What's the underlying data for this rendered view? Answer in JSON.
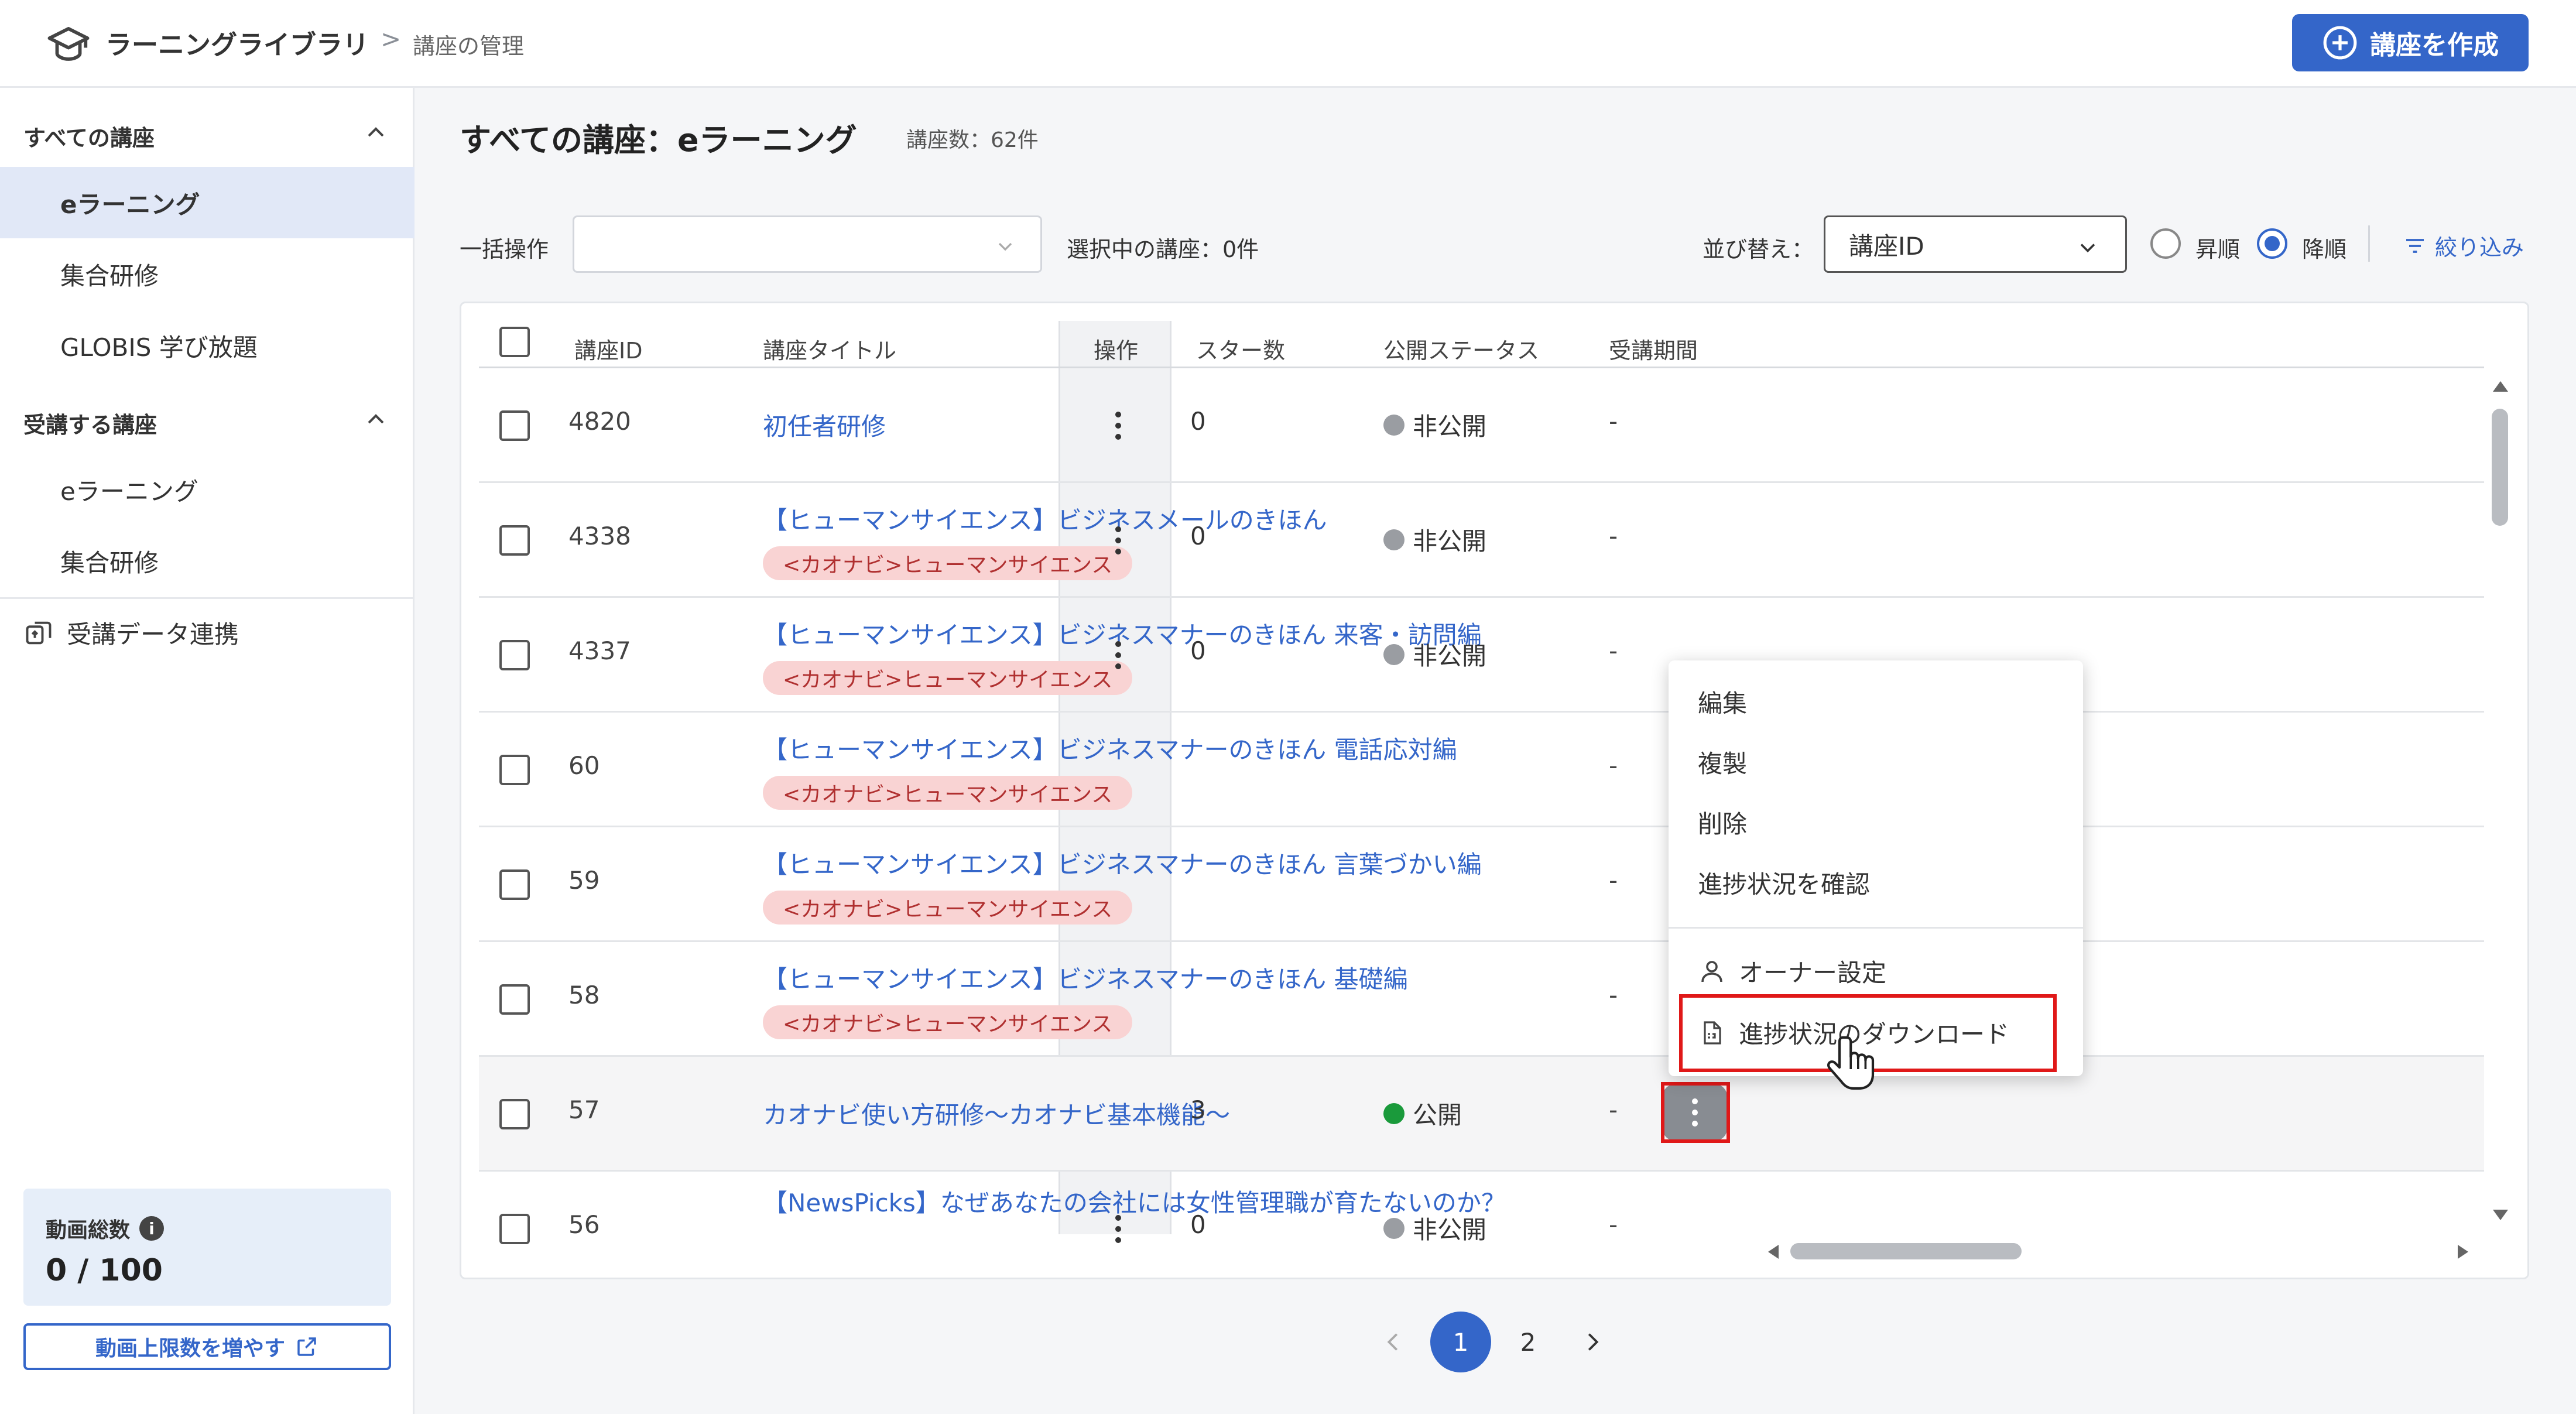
{
  "header": {
    "title": "ラーニングライブラリ",
    "breadcrumb_separator": ">",
    "breadcrumb_current": "講座の管理",
    "create_button": "講座を作成"
  },
  "sidebar": {
    "section_all": "すべての講座",
    "all_items": [
      "eラーニング",
      "集合研修",
      "GLOBIS 学び放題"
    ],
    "section_enrolled": "受講する講座",
    "enrolled_items": [
      "eラーニング",
      "集合研修"
    ],
    "data_sync": "受講データ連携",
    "video_total_label": "動画総数",
    "video_total_value": "0 / 100",
    "increase_button": "動画上限数を増やす"
  },
  "main": {
    "title": "すべての講座：eラーニング",
    "count": "講座数：62件"
  },
  "toolbar": {
    "bulk_label": "一括操作",
    "bulk_placeholder": "",
    "selected_label": "選択中の講座：0件",
    "sort_label": "並び替え：",
    "sort_value": "講座ID",
    "asc_label": "昇順",
    "desc_label": "降順",
    "filter_label": "絞り込み"
  },
  "table": {
    "headers": {
      "id": "講座ID",
      "title": "講座タイトル",
      "ops": "操作",
      "stars": "スター数",
      "status": "公開ステータス",
      "period": "受講期間"
    },
    "rows": [
      {
        "id": "4820",
        "title": "初任者研修",
        "tag": "",
        "stars": "0",
        "status": "非公開",
        "period": "-"
      },
      {
        "id": "4338",
        "title": "【ヒューマンサイエンス】ビジネスメールのきほん",
        "tag": "<カオナビ>ヒューマンサイエンス",
        "stars": "0",
        "status": "非公開",
        "period": "-"
      },
      {
        "id": "4337",
        "title": "【ヒューマンサイエンス】ビジネスマナーのきほん 来客・訪問編",
        "tag": "<カオナビ>ヒューマンサイエンス",
        "stars": "0",
        "status": "非公開",
        "period": "-"
      },
      {
        "id": "60",
        "title": "【ヒューマンサイエンス】ビジネスマナーのきほん 電話応対編",
        "tag": "<カオナビ>ヒューマンサイエンス",
        "stars": "",
        "status": "",
        "period": "-"
      },
      {
        "id": "59",
        "title": "【ヒューマンサイエンス】ビジネスマナーのきほん 言葉づかい編",
        "tag": "<カオナビ>ヒューマンサイエンス",
        "stars": "",
        "status": "",
        "period": "-"
      },
      {
        "id": "58",
        "title": "【ヒューマンサイエンス】ビジネスマナーのきほん 基礎編",
        "tag": "<カオナビ>ヒューマンサイエンス",
        "stars": "",
        "status": "",
        "period": "-"
      },
      {
        "id": "57",
        "title": "カオナビ使い方研修〜カオナビ基本機能〜",
        "tag": "",
        "stars": "3",
        "status": "公開",
        "period": "-"
      },
      {
        "id": "56",
        "title": "【NewsPicks】なぜあなたの会社には女性管理職が育たないのか？",
        "tag": "",
        "stars": "0",
        "status": "非公開",
        "period": "-"
      }
    ]
  },
  "menu": {
    "items": [
      "編集",
      "複製",
      "削除",
      "進捗状況を確認"
    ],
    "owner": "オーナー設定",
    "download": "進捗状況のダウンロード"
  },
  "pagination": {
    "pages": [
      "1",
      "2"
    ],
    "current": "1"
  },
  "colors": {
    "accent": "#3466c9",
    "public": "#1a9a3b",
    "private": "#9a9da2",
    "tag_bg": "#f9d3d3",
    "highlight": "#e01818"
  }
}
